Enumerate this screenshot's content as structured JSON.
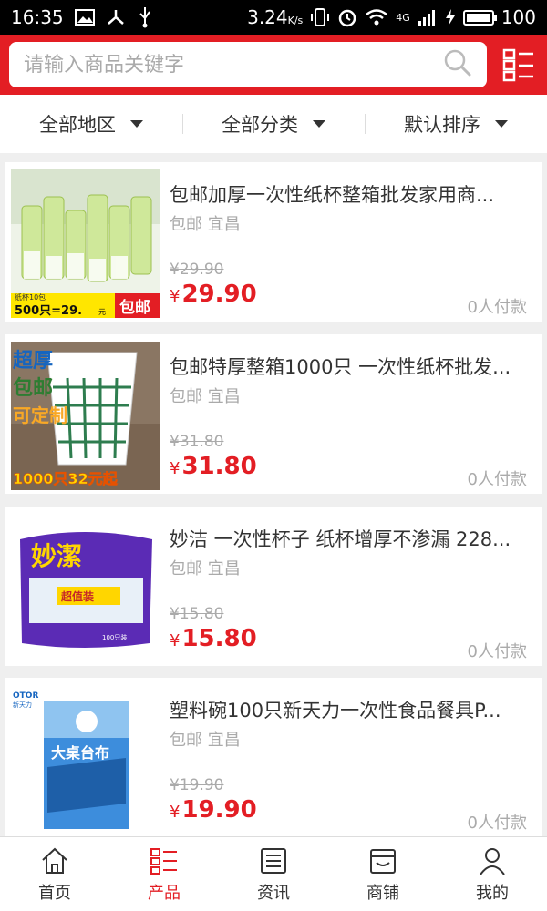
{
  "status_bar": {
    "time": "16:35",
    "speed": "3.24",
    "speed_unit": "K/s",
    "network": "4G",
    "battery": "100"
  },
  "search": {
    "placeholder": "请输入商品关键字",
    "value": ""
  },
  "filters": [
    {
      "label": "全部地区"
    },
    {
      "label": "全部分类"
    },
    {
      "label": "默认排序"
    }
  ],
  "products": [
    {
      "title": "包邮加厚一次性纸杯整箱批发家用商...",
      "tag": "包邮",
      "location": "宜昌",
      "old_price": "¥29.90",
      "currency": "¥",
      "price": "29.90",
      "paid": "0人付款",
      "image_text": [
        "纸杯10包",
        "500只=29.",
        "元",
        "包邮"
      ]
    },
    {
      "title": "包邮特厚整箱1000只 一次性纸杯批发...",
      "tag": "包邮",
      "location": "宜昌",
      "old_price": "¥31.80",
      "currency": "¥",
      "price": "31.80",
      "paid": "0人付款",
      "image_text": [
        "超厚",
        "包邮",
        "可定制",
        "1000只32元起"
      ]
    },
    {
      "title": "妙洁 一次性杯子 纸杯增厚不渗漏 228...",
      "tag": "包邮",
      "location": "宜昌",
      "old_price": "¥15.80",
      "currency": "¥",
      "price": "15.80",
      "paid": "0人付款",
      "image_text": [
        "妙潔",
        "超值装",
        "100只装"
      ]
    },
    {
      "title": "塑料碗100只新天力一次性食品餐具P...",
      "tag": "包邮",
      "location": "宜昌",
      "old_price": "¥19.90",
      "currency": "¥",
      "price": "19.90",
      "paid": "0人付款",
      "image_text": [
        "OTOR",
        "新天力",
        "大桌台布"
      ]
    }
  ],
  "tabbar": [
    {
      "label": "首页",
      "icon": "home-icon"
    },
    {
      "label": "产品",
      "icon": "list-icon"
    },
    {
      "label": "资讯",
      "icon": "news-icon"
    },
    {
      "label": "商铺",
      "icon": "shop-icon"
    },
    {
      "label": "我的",
      "icon": "user-icon"
    }
  ],
  "colors": {
    "brand": "#e31e24",
    "muted": "#aaaaaa"
  }
}
